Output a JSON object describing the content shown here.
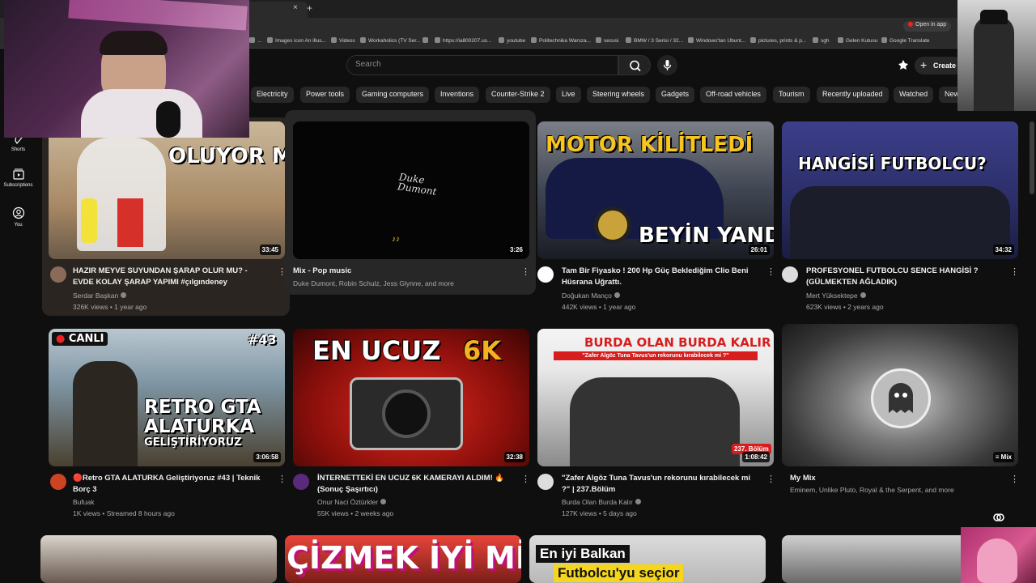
{
  "browser": {
    "tab_close": "×",
    "new_tab": "+",
    "open_in_app": "Open in app",
    "bookmarks": [
      "...",
      "Images icon An illus...",
      "Videos",
      "Workaholics (TV Ser...",
      "",
      "https://ia800207.us...",
      "youtube",
      "Politechnika Warsza...",
      "secusi",
      "BMW / 3 Serisi / 32...",
      "Windows'tan Ubunt...",
      "pictures, prints & p...",
      "sgh",
      "Gelen Kutusu",
      "Google Translate"
    ]
  },
  "masthead": {
    "search_placeholder": "Search",
    "create_label": "Create",
    "create_plus": "+"
  },
  "rail": [
    {
      "label": "Shorts"
    },
    {
      "label": "Subscriptions"
    },
    {
      "label": "You"
    }
  ],
  "chips": [
    "Electricity",
    "Power tools",
    "Gaming computers",
    "Inventions",
    "Counter-Strike 2",
    "Live",
    "Steering wheels",
    "Gadgets",
    "Off-road vehicles",
    "Tourism",
    "Recently uploaded",
    "Watched",
    "New"
  ],
  "videos": [
    {
      "title": "HAZIR MEYVE SUYUNDAN ŞARAP OLUR MU? - EVDE KOLAY ŞARAP YAPIMI #çılgındeney",
      "channel": "Serdar Başkan",
      "meta": "326K views • 1 year ago",
      "duration": "33:45",
      "thumb_text": "OLUYOR MU?"
    },
    {
      "title": "Mix - Pop music",
      "channel": "Duke Dumont, Robin Schulz, Jess Glynne, and more",
      "meta": "",
      "duration": "3:26",
      "thumb_text": "Duke Dumont"
    },
    {
      "title": "Tam Bir Fiyasko ! 200 Hp Güç Beklediğim Clio Beni Hüsrana Uğrattı.",
      "channel": "Doğukan Manço",
      "meta": "442K views • 1 year ago",
      "duration": "26:01",
      "thumb_text": "MOTOR KİLİTLEDİ",
      "thumb_text2": "BEYİN YANDI !"
    },
    {
      "title": "PROFESYONEL FUTBOLCU SENCE HANGİSİ ? (GÜLMEKTEN AĞLADIK)",
      "channel": "Mert Yüksektepe",
      "meta": "623K views • 2 years ago",
      "duration": "34:32",
      "thumb_text": "HANGİSİ FUTBOLCU?"
    },
    {
      "title": "🔴Retro GTA ALATURKA Geliştiriyoruz #43 | Teknik Borç 3",
      "channel": "Bufuak",
      "meta": "1K views • Streamed 8 hours ago",
      "duration": "3:06:58",
      "thumb_text": "RETRO GTA",
      "thumb_text2": "ALATURKA",
      "thumb_text3": "GELİŞTİRİYORUZ",
      "live": "CANLI",
      "episode": "#43"
    },
    {
      "title": "İNTERNETTEKİ EN UCUZ 6K KAMERAYI ALDIM! 🔥 (Sonuç Şaşırtıcı)",
      "channel": "Onur Naci Öztürkler",
      "meta": "55K views • 2 weeks ago",
      "duration": "32:38",
      "thumb_text": "EN UCUZ",
      "thumb_text2": "6K"
    },
    {
      "title": "\"Zafer Algöz Tuna Tavus'un rekorunu kırabilecek mi ?\" | 237.Bölüm",
      "channel": "Burda Olan Burda Kalır",
      "meta": "127K views • 5 days ago",
      "duration": "1:08:42",
      "thumb_text": "BURDA OLAN BURDA KALIR",
      "thumb_text2": "\"Zafer Algöz Tuna Tavus'un rekorunu kırabilecek mi ?\"",
      "episode": "237. Bölüm"
    },
    {
      "title": "My Mix",
      "channel": "Eminem, Unlike Pluto, Royal & the Serpent, and more",
      "meta": "",
      "duration": "Mix",
      "thumb_text": ""
    }
  ],
  "row3": {
    "thumb_text_2": "ÇİZMEK İYİ Mİ?",
    "thumb_text_3a": "En iyi Balkan",
    "thumb_text_3b": "Futbolcu'yu seçior"
  },
  "colors": {
    "bg": "#0f0f0f",
    "chip": "#272727",
    "live_red": "#d40f2d",
    "text_secondary": "#aaaaaa"
  }
}
